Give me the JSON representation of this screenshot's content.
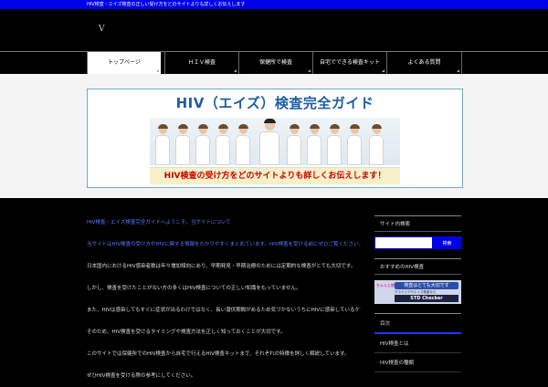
{
  "topbar": {
    "text": "HIV検査・エイズ検査の正しい受け方をどのサイトよりも詳しくお伝えします"
  },
  "header": {
    "logo": "V"
  },
  "nav": {
    "items": [
      {
        "label": "トップページ"
      },
      {
        "label": "ＨＩＶ検査"
      },
      {
        "label": "保健所で検査"
      },
      {
        "label": "自宅でできる検査キット"
      },
      {
        "label": "よくある質問"
      }
    ]
  },
  "banner": {
    "title": "HIV（エイズ）検査完全ガイド",
    "subtitle": "HIV検査の受け方をどのサイトよりも詳しくお伝えします！"
  },
  "main": {
    "lines": [
      "HIV検査・エイズ検査完全ガイドへようこそ。当サイトについて",
      "当サイトはHIV検査の受け方やHIVに関する情報をわかりやすくまとめています。HIV検査を受ける前にぜひご覧ください。",
      "日本国内におけるHIV感染者数は年々増加傾向にあり、早期発見・早期治療のためには定期的な検査がとても大切です。",
      "しかし、検査を受けたことがない方の多くはHIV検査についての正しい知識をもっていません。",
      "また、HIVは感染してもすぐに症状が出るわけではなく、長い潜伏期間があるため気づかないうちにHIVに感染しているケースも少なくありません。",
      "そのため、HIV検査を受けるタイミングや検査方法を正しく知っておくことが大切です。",
      "このサイトでは保健所でのHIV検査から自宅で行えるHIV検査キットまで、それぞれの特徴を詳しく解説しています。",
      "ぜひHIV検査を受ける際の参考にしてください。"
    ]
  },
  "sidebar": {
    "search_heading": "サイト内検索",
    "search_button": "検索",
    "ad_heading": "おすすめのHIV検査",
    "ad": {
      "tag": "ちゃんと検査",
      "line1": "検査はとても大切です",
      "line2": "クラミジアやエイズ検査なら",
      "brand": "STD Checker"
    },
    "menu_heading": "目次",
    "menu_items": [
      "HIV検査とは",
      "HIV検査の種類"
    ]
  }
}
